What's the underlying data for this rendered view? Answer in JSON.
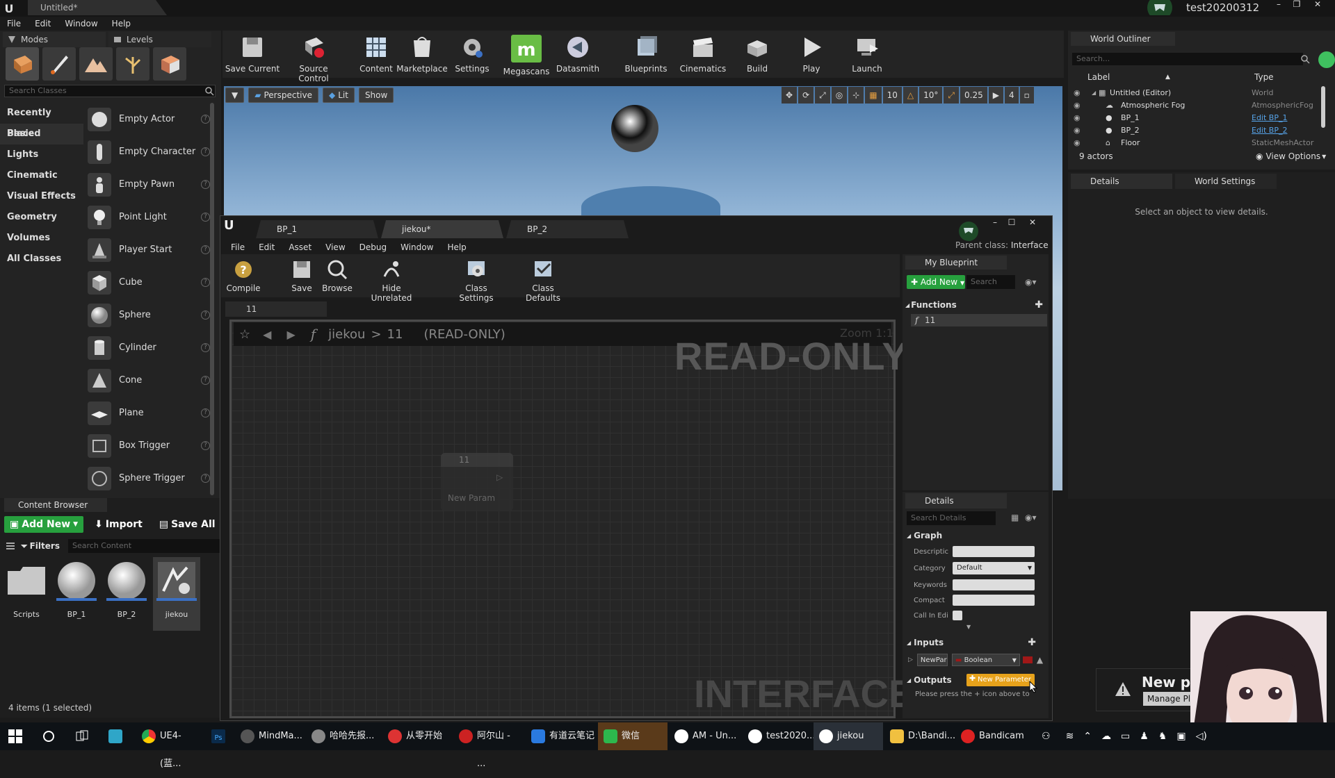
{
  "window": {
    "doc_tab": "Untitled*",
    "menu": [
      "File",
      "Edit",
      "Window",
      "Help"
    ],
    "user": "test20200312"
  },
  "left_panel": {
    "tabs": [
      "Modes",
      "Levels"
    ],
    "search_placeholder": "Search Classes",
    "categories": [
      "Recently Placed",
      "Basic",
      "Lights",
      "Cinematic",
      "Visual Effects",
      "Geometry",
      "Volumes",
      "All Classes"
    ],
    "active_category": "Basic",
    "placed_items": [
      "Empty Actor",
      "Empty Character",
      "Empty Pawn",
      "Point Light",
      "Player Start",
      "Cube",
      "Sphere",
      "Cylinder",
      "Cone",
      "Plane",
      "Box Trigger",
      "Sphere Trigger"
    ],
    "help_glyph": "?"
  },
  "content_browser": {
    "tab": "Content Browser",
    "add_new": "Add New",
    "import": "Import",
    "save_all": "Save All",
    "filters": "Filters",
    "search_placeholder": "Search Content",
    "assets": [
      "Scripts",
      "BP_1",
      "BP_2",
      "jiekou"
    ],
    "selected_asset": "jiekou",
    "status": "4 items (1 selected)"
  },
  "main_toolbar": {
    "buttons": [
      "Save Current",
      "Source Control",
      "Content",
      "Marketplace",
      "Settings",
      "Megascans",
      "Datasmith",
      "Blueprints",
      "Cinematics",
      "Build",
      "Play",
      "Launch"
    ]
  },
  "viewport": {
    "perspective": "Perspective",
    "lit": "Lit",
    "show": "Show",
    "grid_snap": "10",
    "rot_snap": "10°",
    "scale_snap": "0.25",
    "cam_speed": "4"
  },
  "bp_editor": {
    "tabs": [
      "BP_1",
      "jiekou*",
      "BP_2"
    ],
    "active_tab": "jiekou*",
    "menu": [
      "File",
      "Edit",
      "Asset",
      "View",
      "Debug",
      "Window",
      "Help"
    ],
    "parent_class_label": "Parent class:",
    "parent_class_value": "Interface",
    "toolbar": [
      "Compile",
      "Save",
      "Browse",
      "Hide Unrelated",
      "Class Settings",
      "Class Defaults"
    ],
    "graph_tab": "11",
    "breadcrumb": {
      "root": "jiekou",
      "sep": ">",
      "leaf": "11",
      "suffix": "(READ-ONLY)"
    },
    "zoom": "Zoom 1:1",
    "watermark_readonly": "READ-ONLY",
    "watermark_interface": "INTERFACE",
    "node": {
      "title": "11",
      "pin": "New Param"
    }
  },
  "my_blueprint": {
    "tab": "My Blueprint",
    "add_new": "Add New",
    "search_placeholder": "Search",
    "functions_header": "Functions",
    "function_item": "11"
  },
  "details": {
    "tab": "Details",
    "search_placeholder": "Search Details",
    "graph_header": "Graph",
    "description_label": "Descriptic",
    "category_label": "Category",
    "category_value": "Default",
    "keywords_label": "Keywords",
    "compact_label": "Compact",
    "callin_label": "Call In Edi",
    "inputs_header": "Inputs",
    "param_name": "NewPar",
    "param_type": "Boolean",
    "outputs_header": "Outputs",
    "new_param_btn": "New Parameter",
    "outputs_hint": "Please press the + icon above to"
  },
  "world_outliner": {
    "tab": "World Outliner",
    "search_placeholder": "Search...",
    "col_label": "Label",
    "col_type": "Type",
    "rows": [
      {
        "label": "Untitled (Editor)",
        "type": "World",
        "link": false
      },
      {
        "label": "Atmospheric Fog",
        "type": "AtmosphericFog",
        "link": false
      },
      {
        "label": "BP_1",
        "type": "Edit BP_1",
        "link": true
      },
      {
        "label": "BP_2",
        "type": "Edit BP_2",
        "link": true
      },
      {
        "label": "Floor",
        "type": "StaticMeshActor",
        "link": false
      }
    ],
    "actor_count": "9 actors",
    "view_options": "View Options"
  },
  "right_details": {
    "tab1": "Details",
    "tab2": "World Settings",
    "hint": "Select an object to view details."
  },
  "notification": {
    "title": "New plu",
    "button": "Manage Plu"
  },
  "taskbar": {
    "items": [
      "UE4- (蓝...",
      "MindMa...",
      "哈哈先报...",
      "从零开始",
      "阿尔山 - ...",
      "有道云笔记",
      "微信",
      "AM - Un...",
      "test2020...",
      "jiekou",
      "D:\\Bandi...",
      "Bandicam"
    ]
  },
  "colors": {
    "accent_green": "#27a03e",
    "accent_orange": "#e7a21b",
    "link_blue": "#56a3e8"
  }
}
